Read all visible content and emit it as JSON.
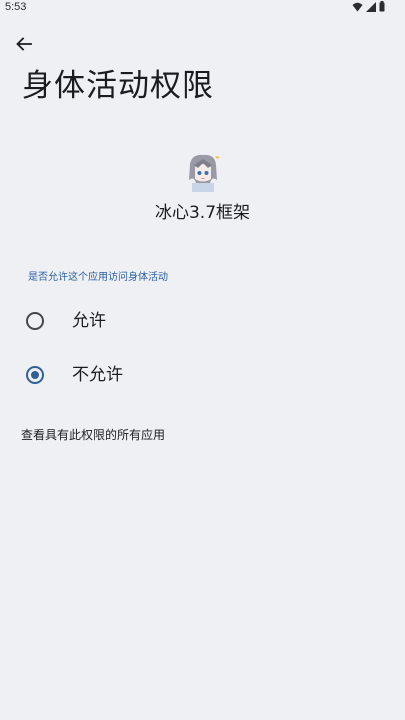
{
  "status_bar": {
    "time": "5:53",
    "icons": [
      "wifi-icon",
      "signal-icon",
      "battery-icon"
    ]
  },
  "header": {
    "back_icon": "arrow-back-icon",
    "title": "身体活动权限"
  },
  "app": {
    "icon": "app-avatar-icon",
    "name": "冰心3.7框架"
  },
  "permission": {
    "question": "是否允许这个应用访问身体活动",
    "options": [
      {
        "label": "允许",
        "selected": false
      },
      {
        "label": "不允许",
        "selected": true
      }
    ]
  },
  "footer": {
    "see_all_label": "查看具有此权限的所有应用"
  },
  "colors": {
    "background": "#eff0f4",
    "accent": "#2f6296",
    "label_blue": "#2a5fa0",
    "text": "#1b1c1f"
  }
}
